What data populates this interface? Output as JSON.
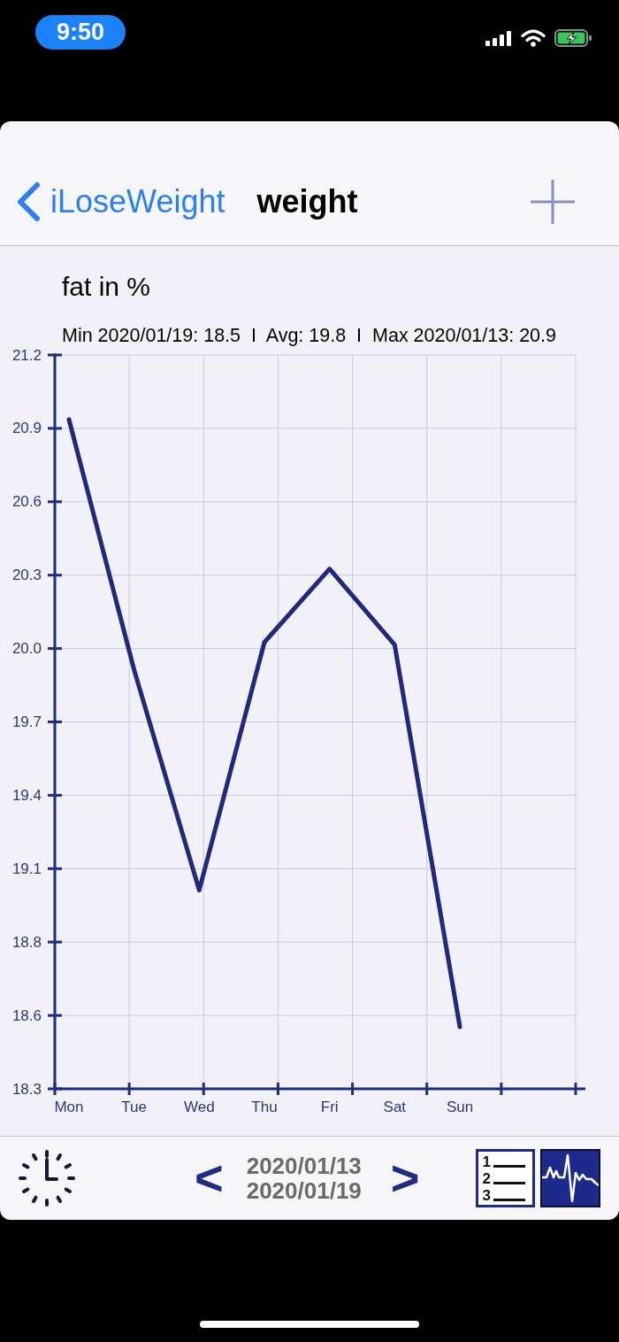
{
  "status_bar": {
    "time": "9:50"
  },
  "nav_bar": {
    "back_label": "iLoseWeight",
    "title": "weight"
  },
  "chart_panel": {
    "summary": "Min 2020/01/19: 18.5  I  Avg: 19.8  I  Max 2020/01/13: 20.9",
    "chart_data": {
      "type": "line",
      "title": "fat in %",
      "grid": true,
      "categories": [
        "Mon",
        "Tue",
        "Wed",
        "Thu",
        "Fri",
        "Sat",
        "Sun"
      ],
      "values": [
        20.91,
        19.92,
        19.05,
        20.03,
        20.32,
        20.02,
        18.51
      ],
      "ylim": [
        18.265,
        21.165
      ],
      "yticks": [
        {
          "value": 21.165,
          "label": "21.2"
        },
        {
          "value": 20.875,
          "label": "20.9"
        },
        {
          "value": 20.585,
          "label": "20.6"
        },
        {
          "value": 20.295,
          "label": "20.3"
        },
        {
          "value": 20.005,
          "label": "20.0"
        },
        {
          "value": 19.715,
          "label": "19.7"
        },
        {
          "value": 19.425,
          "label": "19.4"
        },
        {
          "value": 19.135,
          "label": "19.1"
        },
        {
          "value": 18.845,
          "label": "18.8"
        },
        {
          "value": 18.555,
          "label": "18.6"
        },
        {
          "value": 18.265,
          "label": "18.3"
        }
      ]
    }
  },
  "bottom_bar": {
    "prev_label": "<",
    "date_from": "2020/01/13",
    "date_to": "2020/01/19",
    "next_label": ">",
    "list_digits": [
      "1",
      "2",
      "3"
    ]
  }
}
